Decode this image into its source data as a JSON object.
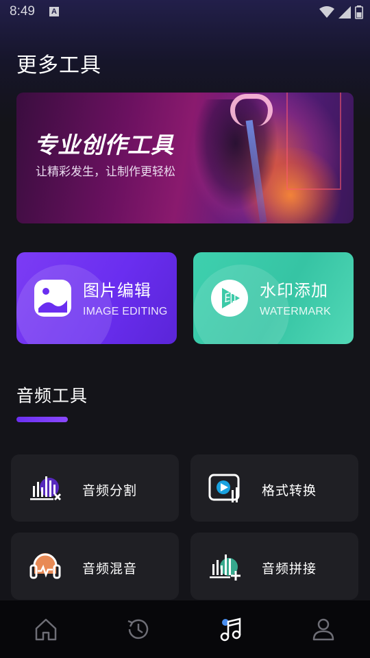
{
  "status_bar": {
    "time": "8:49",
    "notification_icon": "A"
  },
  "page": {
    "title": "更多工具"
  },
  "banner": {
    "title": "专业创作工具",
    "subtitle": "让精彩发生，让制作更轻松"
  },
  "features": [
    {
      "title": "图片编辑",
      "subtitle": "IMAGE EDITING",
      "icon": "image-icon",
      "color": "#6a2ef0"
    },
    {
      "title": "水印添加",
      "subtitle": "WATERMARK",
      "icon": "watermark-stamp-icon",
      "color": "#3ccaa8"
    }
  ],
  "audio_section": {
    "title": "音频工具",
    "tools": [
      {
        "label": "音频分割",
        "icon": "audio-split-icon"
      },
      {
        "label": "格式转换",
        "icon": "format-convert-icon"
      },
      {
        "label": "音频混音",
        "icon": "audio-mix-icon"
      },
      {
        "label": "音频拼接",
        "icon": "audio-join-icon"
      }
    ]
  },
  "bottom_nav": {
    "items": [
      {
        "icon": "home-icon",
        "active": false
      },
      {
        "icon": "history-icon",
        "active": false
      },
      {
        "icon": "music-icon",
        "active": true
      },
      {
        "icon": "profile-icon",
        "active": false
      }
    ]
  },
  "colors": {
    "accent_purple": "#6b30f0",
    "accent_teal": "#3ccaa8",
    "card_bg": "#1f1f24",
    "nav_bg": "#07070a"
  }
}
